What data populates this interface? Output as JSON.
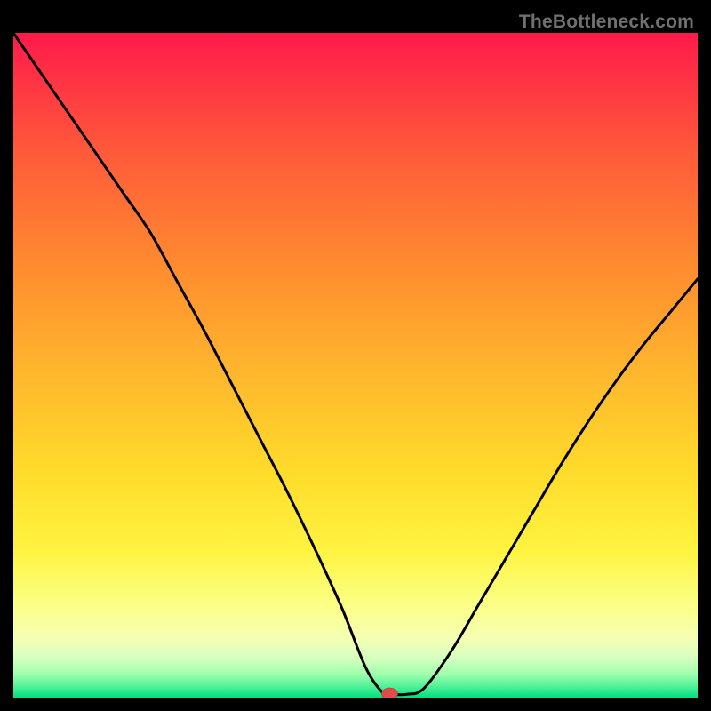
{
  "watermark": "TheBottleneck.com",
  "chart_data": {
    "type": "line",
    "title": "",
    "xlabel": "",
    "ylabel": "",
    "xlim": [
      0,
      100
    ],
    "ylim": [
      0,
      100
    ],
    "grid": false,
    "legend": false,
    "background_gradient": [
      "#ff1a4b",
      "#ff7a30",
      "#ffb72d",
      "#ffe42c",
      "#fff85e",
      "#f9ffad",
      "#9fffb8",
      "#00e67a"
    ],
    "series": [
      {
        "name": "bottleneck-curve",
        "x": [
          0,
          4,
          8,
          12,
          16,
          20,
          24,
          28,
          32,
          36,
          40,
          44,
          48,
          51.5,
          54,
          55,
          57.5,
          60,
          64,
          68,
          72,
          76,
          80,
          84,
          88,
          92,
          96,
          100
        ],
        "values": [
          100,
          94,
          88,
          82,
          76,
          70,
          62.5,
          55,
          47,
          39,
          31,
          22.5,
          13.5,
          4.5,
          0.7,
          0.5,
          0.5,
          1.4,
          7,
          14,
          21,
          28,
          35,
          41.5,
          47.5,
          53,
          58,
          63
        ]
      }
    ],
    "marker": {
      "name": "optimum-marker",
      "x": 55,
      "y": 0.6,
      "color": "#e44a4a"
    }
  }
}
